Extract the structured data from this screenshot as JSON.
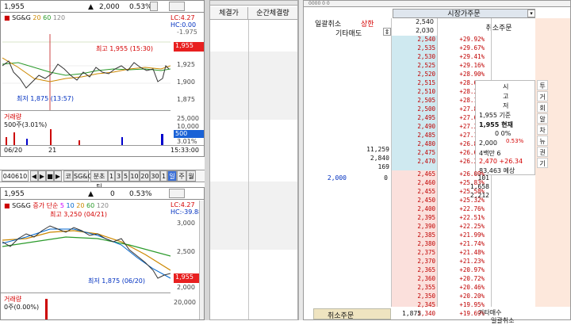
{
  "chart1": {
    "price": "1,955",
    "volume": "2,000",
    "change_pct": "0.53%",
    "name": "SG&G",
    "ma_labels": [
      "20",
      "60",
      "120"
    ],
    "lc_label": "LC:4.27",
    "hc_label": "HC:0.00",
    "hc_sub": "-1.975",
    "high_label": "최고 1,955 (15:30)",
    "low_label": "최저 1,875 (13:57)",
    "y_ticks": [
      "1,955",
      "1,925",
      "1,900",
      "1,875"
    ],
    "current_tag": "1,955",
    "volume_title": "거래량",
    "volume_value": "500주(3.01%)",
    "vol_ticks": [
      "25,000",
      "10,000",
      "500",
      "3.01%"
    ],
    "x_labels": [
      "06/20",
      "21",
      "15:33:00"
    ]
  },
  "toolbar": {
    "code": "040610",
    "items": [
      "코",
      "SG&G",
      "분초틱",
      "1",
      "3",
      "5",
      "10",
      "20",
      "30",
      "1",
      "일",
      "주",
      "월"
    ]
  },
  "chart2": {
    "price": "1,955",
    "volume": "0",
    "change_pct": "0.53%",
    "name": "SG&G",
    "ma_title": "증가 단순",
    "ma_labels": [
      "5",
      "10",
      "20",
      "60",
      "120"
    ],
    "lc_label": "LC:4.27",
    "hc_label": "HC:-39.88",
    "high_label": "최고 3,250 (04/21)",
    "low_label": "최저 1,875 (06/20)",
    "y_ticks": [
      "3,000",
      "2,500",
      "2,000"
    ],
    "current_tag": "1,955",
    "volume_title": "거래량",
    "volume_value": "0주(0.00%)",
    "vol_ticks": [
      "20,000"
    ]
  },
  "trades": {
    "headers": [
      "체결가",
      "순간체결량"
    ]
  },
  "orderbook": {
    "header_left": "0000 0 0",
    "title": "시장가주문",
    "left_tabs": [
      "일괄취소",
      "상한"
    ],
    "other_ask_label": "기타매도",
    "cancel_order_top": "취소주문",
    "upper_limit": "2,540",
    "upper_price_shown": "2,030",
    "asks": [
      [
        "2,540",
        "+29.92%"
      ],
      [
        "2,535",
        "+29.67%"
      ],
      [
        "2,530",
        "+29.41%"
      ],
      [
        "2,525",
        "+29.16%"
      ],
      [
        "2,520",
        "+28.90%"
      ],
      [
        "2,515",
        "+28.64%"
      ],
      [
        "2,510",
        "+28.39%"
      ],
      [
        "2,505",
        "+28.13%"
      ],
      [
        "2,500",
        "+27.88%"
      ],
      [
        "2,495",
        "+27.62%"
      ],
      [
        "2,490",
        "+27.37%"
      ],
      [
        "2,485",
        "+27.11%"
      ],
      [
        "2,480",
        "+26.85%"
      ],
      [
        "2,475",
        "+26.60%"
      ],
      [
        "2,470",
        "+26.34%"
      ]
    ],
    "ask_qty": [
      "11,259",
      "2,840",
      "169"
    ],
    "bids": [
      [
        "2,465",
        "+26.09%"
      ],
      [
        "2,460",
        "+25.83%"
      ],
      [
        "2,455",
        "+25.58%"
      ],
      [
        "2,450",
        "+25.32%"
      ],
      [
        "2,400",
        "+22.76%"
      ],
      [
        "2,395",
        "+22.51%"
      ],
      [
        "2,390",
        "+22.25%"
      ],
      [
        "2,385",
        "+21.99%"
      ],
      [
        "2,380",
        "+21.74%"
      ],
      [
        "2,375",
        "+21.48%"
      ],
      [
        "2,370",
        "+21.23%"
      ],
      [
        "2,365",
        "+20.97%"
      ],
      [
        "2,360",
        "+20.72%"
      ],
      [
        "2,355",
        "+20.46%"
      ],
      [
        "2,350",
        "+20.20%"
      ],
      [
        "2,345",
        "+19.95%"
      ],
      [
        "2,340",
        "+19.69%"
      ]
    ],
    "bid_qty": [
      "101",
      "1,658",
      "2,212"
    ],
    "left_bid_qty": "2,000",
    "left_bid_zero": "0",
    "info": {
      "v_chars": [
        "시",
        "고",
        "저"
      ],
      "base": "1,955 기준",
      "now": "1,955 현재",
      "now_pct": "0 0%",
      "row3": "2,000",
      "row3_pct": "0.53%",
      "million": "4백만 6",
      "expected": "83,463 예상",
      "expected_pct": "2,470 +26.34"
    },
    "side_tabs": [
      "투",
      "거",
      "회",
      "알",
      "차",
      "뉴",
      "권",
      "기"
    ],
    "bottom_cancel": "취소주문",
    "bottom_other_bid": "기타매수",
    "bottom_total": "1,875",
    "bottom_batch_cancel": "일괄취소"
  }
}
